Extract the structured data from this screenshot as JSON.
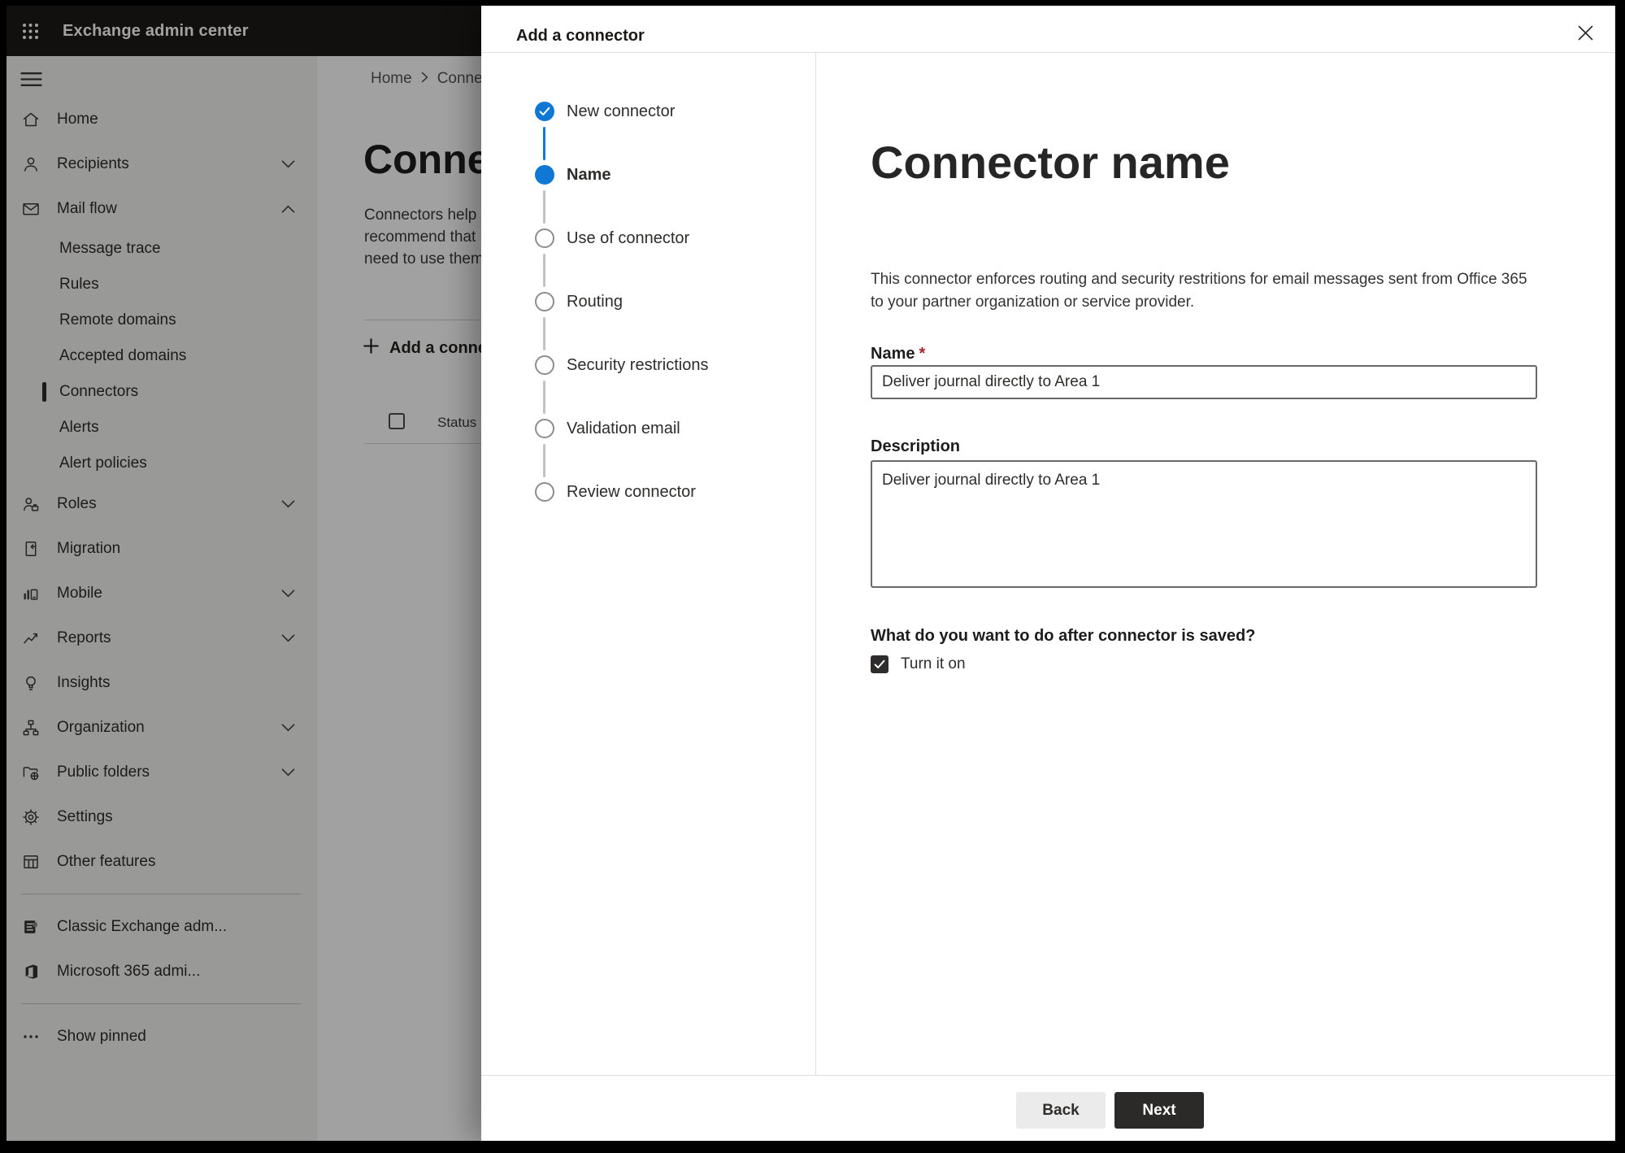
{
  "header": {
    "app_title": "Exchange admin center"
  },
  "sidebar": {
    "items": [
      {
        "label": "Home",
        "icon": "home-icon"
      },
      {
        "label": "Recipients",
        "icon": "person-icon",
        "chevron": "down"
      },
      {
        "label": "Mail flow",
        "icon": "mail-icon",
        "chevron": "up"
      },
      {
        "label": "Message trace",
        "sub": true
      },
      {
        "label": "Rules",
        "sub": true
      },
      {
        "label": "Remote domains",
        "sub": true
      },
      {
        "label": "Accepted domains",
        "sub": true
      },
      {
        "label": "Connectors",
        "sub": true,
        "selected": true
      },
      {
        "label": "Alerts",
        "sub": true
      },
      {
        "label": "Alert policies",
        "sub": true
      },
      {
        "label": "Roles",
        "icon": "roles-icon",
        "chevron": "down"
      },
      {
        "label": "Migration",
        "icon": "migration-icon"
      },
      {
        "label": "Mobile",
        "icon": "mobile-icon",
        "chevron": "down"
      },
      {
        "label": "Reports",
        "icon": "reports-icon",
        "chevron": "down"
      },
      {
        "label": "Insights",
        "icon": "insights-icon"
      },
      {
        "label": "Organization",
        "icon": "organization-icon",
        "chevron": "down"
      },
      {
        "label": "Public folders",
        "icon": "public-folders-icon",
        "chevron": "down"
      },
      {
        "label": "Settings",
        "icon": "settings-icon"
      },
      {
        "label": "Other features",
        "icon": "other-features-icon"
      },
      {
        "divider": true
      },
      {
        "label": "Classic Exchange adm...",
        "icon": "classic-exchange-icon"
      },
      {
        "label": "Microsoft 365 admi...",
        "icon": "m365-icon"
      },
      {
        "divider": true
      },
      {
        "label": "Show pinned",
        "icon": "more-icon"
      }
    ]
  },
  "page": {
    "breadcrumb": {
      "home": "Home",
      "current": "Connectors"
    },
    "title": "Connectors",
    "intro_lines": [
      "Connectors help",
      "recommend that",
      "need to use them"
    ],
    "add_button": "Add a connector",
    "table": {
      "status_header": "Status"
    }
  },
  "dialog": {
    "title": "Add a connector",
    "steps": [
      {
        "label": "New connector",
        "state": "completed"
      },
      {
        "label": "Name",
        "state": "current"
      },
      {
        "label": "Use of connector",
        "state": "upcoming"
      },
      {
        "label": "Routing",
        "state": "upcoming"
      },
      {
        "label": "Security restrictions",
        "state": "upcoming"
      },
      {
        "label": "Validation email",
        "state": "upcoming"
      },
      {
        "label": "Review connector",
        "state": "upcoming"
      }
    ],
    "content": {
      "heading": "Connector name",
      "description": "This connector enforces routing and security restritions for email messages sent from Office 365 to your partner organization or service provider.",
      "name_label": "Name",
      "required_mark": "*",
      "name_value": "Deliver journal directly to Area 1",
      "description_label": "Description",
      "description_value": "Deliver journal directly to Area 1",
      "after_save_question": "What do you want to do after connector is saved?",
      "turn_on_label": "Turn it on",
      "turn_on_checked": true
    },
    "footer": {
      "back_label": "Back",
      "next_label": "Next"
    }
  },
  "colors": {
    "accent_blue": "#0f78d4",
    "required_red": "#a4262c",
    "next_button_bg": "#2b2a29",
    "header_bg": "#1b1a19"
  }
}
